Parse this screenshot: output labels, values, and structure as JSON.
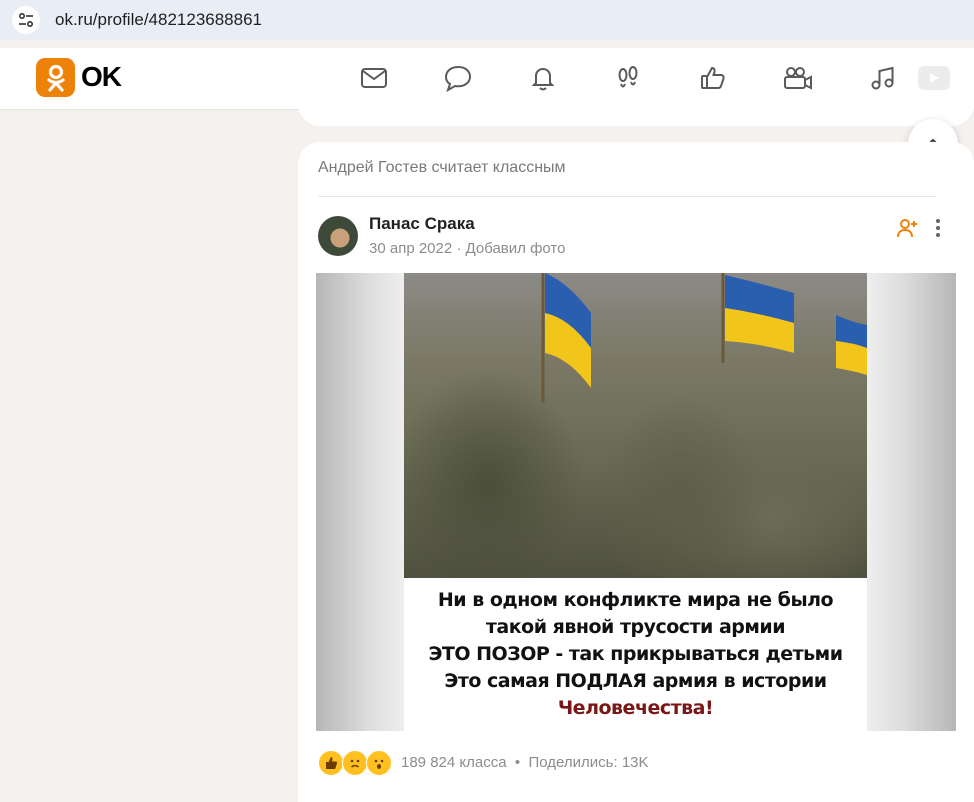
{
  "browser": {
    "url": "ok.ru/profile/482123688861"
  },
  "header": {
    "logo_text": "OK",
    "brand_color": "#ee8208",
    "nav_icons": [
      "mail-icon",
      "chat-icon",
      "bell-icon",
      "footprints-icon",
      "like-icon",
      "video-camera-icon",
      "music-icon",
      "video-icon"
    ]
  },
  "feed": {
    "liked_by": "Андрей Гостев считает классным",
    "post": {
      "author": "Панас Срака",
      "date": "30 апр 2022",
      "separator": "·",
      "action": "Добавил фото",
      "image_caption": {
        "line1": "Ни в одном конфликте мира не было",
        "line2": "такой явной трусости армии",
        "line3": "ЭТО ПОЗОР - так прикрываться детьми",
        "line4": "Это самая ПОДЛАЯ армия в истории",
        "line5": "Человечества!"
      },
      "reactions_icons": [
        "thumbs-up-icon",
        "sad-face-icon",
        "surprised-face-icon"
      ],
      "likes_text": "189 824 класса",
      "dot": "•",
      "shares_text": "Поделились: 13K"
    }
  }
}
